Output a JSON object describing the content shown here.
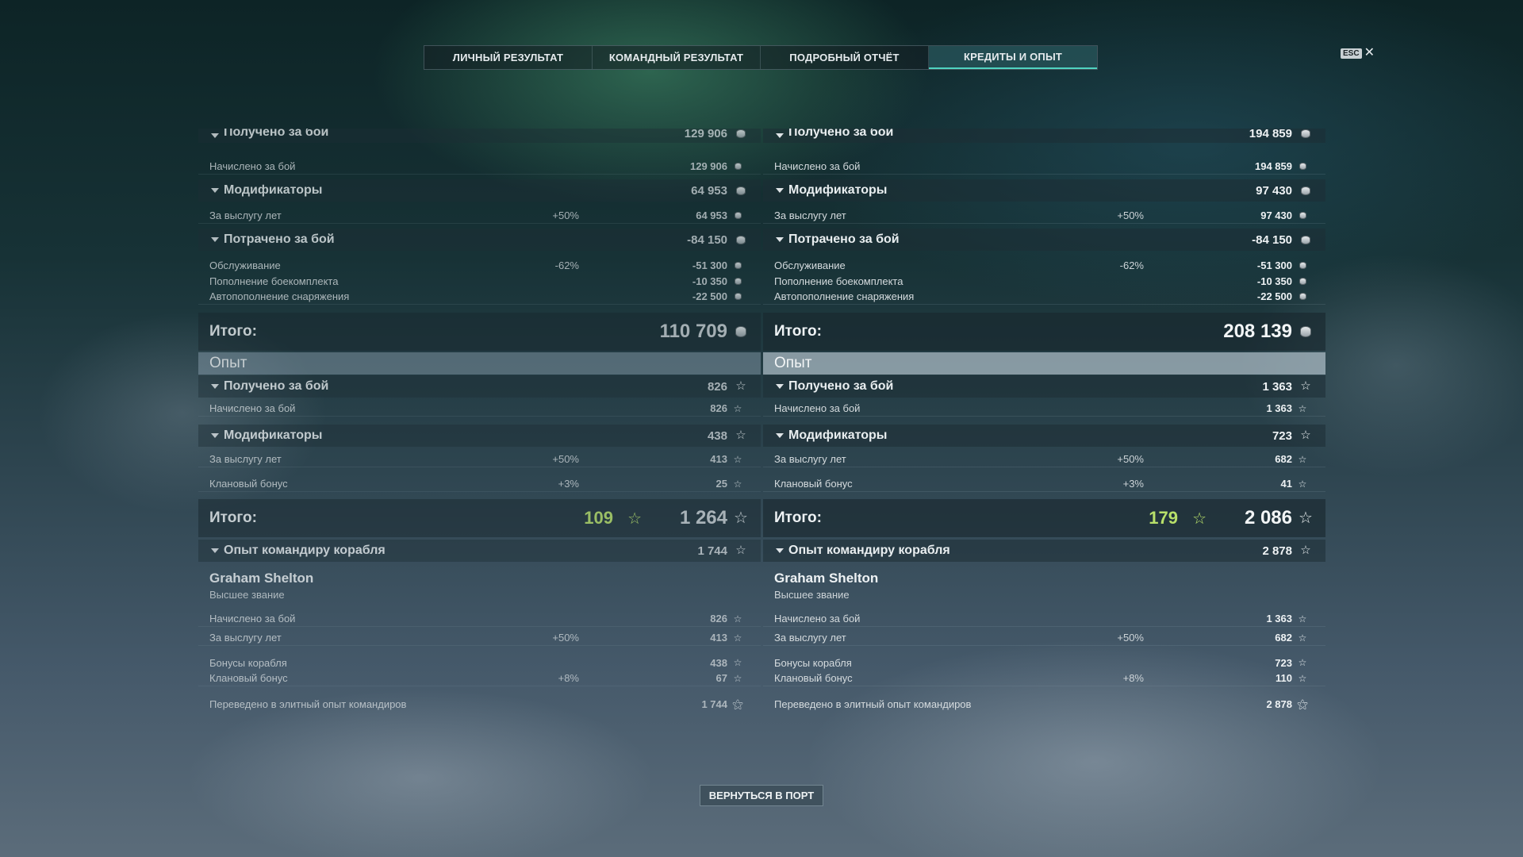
{
  "tabs": [
    "ЛИЧНЫЙ РЕЗУЛЬТАТ",
    "КОМАНДНЫЙ РЕЗУЛЬТАТ",
    "ПОДРОБНЫЙ ОТЧЁТ",
    "КРЕДИТЫ И ОПЫТ"
  ],
  "active_tab": "КРЕДИТЫ И ОПЫТ",
  "esc": {
    "key": "ESC",
    "close": "✕"
  },
  "labels": {
    "received_battle": "Получено за бой",
    "earned_battle": "Начислено за бой",
    "modifiers": "Модификаторы",
    "seniority": "За выслугу лет",
    "spent_battle": "Потрачено за бой",
    "service": "Обслуживание",
    "ammo": "Пополнение боекомплекта",
    "autosupply": "Автопополнение снаряжения",
    "total": "Итого:",
    "experience": "Опыт",
    "clan_bonus": "Клановый бонус",
    "commander_exp": "Опыт командиру корабля",
    "ship_bonuses": "Бонусы корабля",
    "elite_transfer": "Переведено в элитный опыт командиров"
  },
  "left": {
    "credits": {
      "received": "129 906",
      "earned": "129 906",
      "modifiers": "64 953",
      "seniority_pct": "+50%",
      "seniority": "64 953",
      "spent": "-84 150",
      "service_pct": "-62%",
      "service": "-51 300",
      "ammo": "-10 350",
      "autosupply": "-22 500",
      "total": "110 709"
    },
    "exp": {
      "received": "826",
      "earned": "826",
      "modifiers": "438",
      "seniority_pct": "+50%",
      "seniority": "413",
      "clan_pct": "+3%",
      "clan": "25",
      "total_premium": "109",
      "total": "1 264"
    },
    "commander": {
      "total": "1 744",
      "name": "Graham Shelton",
      "rank": "Высшее звание",
      "earned": "826",
      "seniority_pct": "+50%",
      "seniority": "413",
      "ship_bonuses": "438",
      "clan_pct": "+8%",
      "clan": "67",
      "elite": "1 744"
    }
  },
  "right": {
    "credits": {
      "received": "194 859",
      "earned": "194 859",
      "modifiers": "97 430",
      "seniority_pct": "+50%",
      "seniority": "97 430",
      "spent": "-84 150",
      "service_pct": "-62%",
      "service": "-51 300",
      "ammo": "-10 350",
      "autosupply": "-22 500",
      "total": "208 139"
    },
    "exp": {
      "received": "1 363",
      "earned": "1 363",
      "modifiers": "723",
      "seniority_pct": "+50%",
      "seniority": "682",
      "clan_pct": "+3%",
      "clan": "41",
      "total_premium": "179",
      "total": "2 086"
    },
    "commander": {
      "total": "2 878",
      "name": "Graham Shelton",
      "rank": "Высшее звание",
      "earned": "1 363",
      "seniority_pct": "+50%",
      "seniority": "682",
      "ship_bonuses": "723",
      "clan_pct": "+8%",
      "clan": "110",
      "elite": "2 878"
    }
  },
  "return_button": "ВЕРНУТЬСЯ В ПОРТ",
  "colors": {
    "accent": "#4fd3c0",
    "premium": "#b8e06a"
  },
  "icons": {
    "credits": "coin-icon",
    "exp": "star-icon",
    "elite": "elite-exp-icon"
  }
}
